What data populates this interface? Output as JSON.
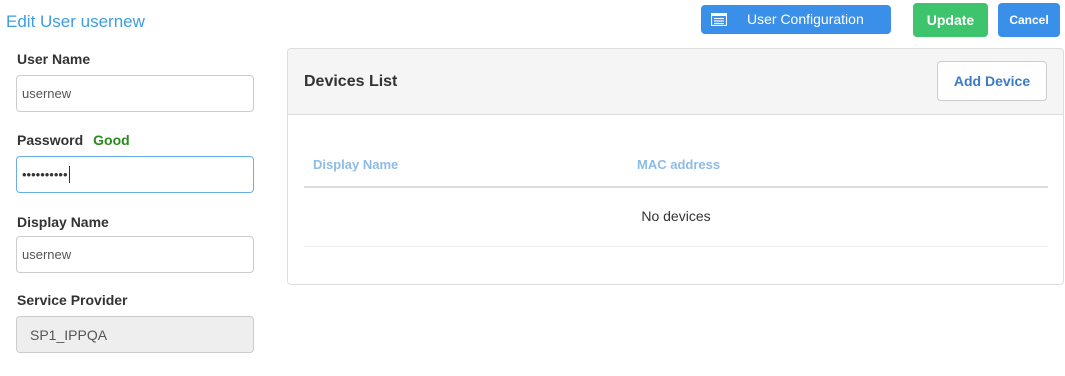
{
  "page": {
    "title": "Edit User usernew"
  },
  "toolbar": {
    "config_label": "User Configuration",
    "config_icon": "list-window-icon",
    "update_label": "Update",
    "cancel_label": "Cancel"
  },
  "form": {
    "username_label": "User Name",
    "username_value": "usernew",
    "password_label": "Password",
    "password_strength": "Good",
    "password_mask": "••••••••••",
    "display_name_label": "Display Name",
    "display_name_value": "usernew",
    "service_provider_label": "Service Provider",
    "service_provider_value": "SP1_IPPQA"
  },
  "devices": {
    "title": "Devices List",
    "add_label": "Add Device",
    "columns": [
      "Display Name",
      "MAC address"
    ],
    "empty_text": "No devices"
  },
  "colors": {
    "title_blue": "#3d9ee0",
    "primary": "#3a8fe8",
    "success": "#3ec46d",
    "strength_good": "#2b8a1f"
  }
}
